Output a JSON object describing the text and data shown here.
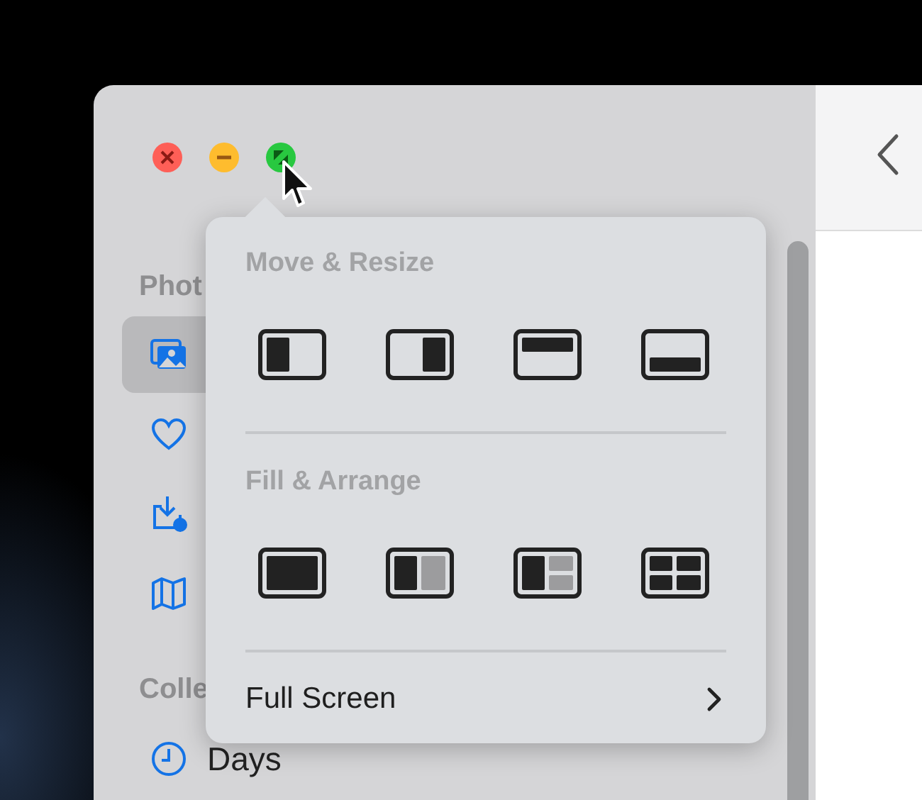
{
  "window": {
    "traffic_lights": [
      {
        "kind": "close"
      },
      {
        "kind": "minimize"
      },
      {
        "kind": "zoom"
      }
    ]
  },
  "sidebar": {
    "sections": [
      {
        "title": "Phot",
        "items": [
          {
            "kind": "photos",
            "selected": true
          },
          {
            "kind": "heart",
            "selected": false
          },
          {
            "kind": "import",
            "selected": false
          },
          {
            "kind": "map",
            "selected": false
          }
        ]
      },
      {
        "title": "Colle",
        "items": [
          {
            "kind": "clock",
            "label": "Days",
            "selected": false
          }
        ]
      }
    ]
  },
  "popover": {
    "sections": [
      {
        "heading": "Move & Resize",
        "layouts": [
          {
            "kind": "left-half"
          },
          {
            "kind": "right-half"
          },
          {
            "kind": "top-half"
          },
          {
            "kind": "bottom-half"
          }
        ]
      },
      {
        "heading": "Fill & Arrange",
        "layouts": [
          {
            "kind": "fill"
          },
          {
            "kind": "left-right"
          },
          {
            "kind": "left-quarters"
          },
          {
            "kind": "quarters"
          }
        ]
      }
    ],
    "footer": {
      "label": "Full Screen"
    }
  }
}
